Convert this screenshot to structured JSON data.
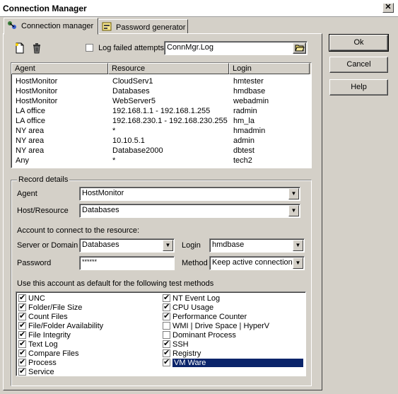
{
  "window": {
    "title": "Connection Manager",
    "close_glyph": "✕"
  },
  "tabs": [
    {
      "label": "Connection manager",
      "active": true
    },
    {
      "label": "Password generator",
      "active": false
    }
  ],
  "toolbar": {
    "log_failed_label": "Log failed attempts",
    "log_file_value": "ConnMgr.Log"
  },
  "list": {
    "headers": {
      "agent": "Agent",
      "resource": "Resource",
      "login": "Login"
    },
    "rows": [
      {
        "agent": "HostMonitor",
        "resource": "CloudServ1",
        "login": "hmtester"
      },
      {
        "agent": "HostMonitor",
        "resource": "Databases",
        "login": "hmdbase"
      },
      {
        "agent": "HostMonitor",
        "resource": "WebServer5",
        "login": "webadmin"
      },
      {
        "agent": "LA office",
        "resource": "192.168.1.1 - 192.168.1.255",
        "login": "radmin"
      },
      {
        "agent": "LA office",
        "resource": "192.168.230.1 - 192.168.230.255",
        "login": "hm_la"
      },
      {
        "agent": "NY area",
        "resource": "*",
        "login": "hmadmin"
      },
      {
        "agent": "NY area",
        "resource": "10.10.5.1",
        "login": "admin"
      },
      {
        "agent": "NY area",
        "resource": "Database2000",
        "login": "dbtest"
      },
      {
        "agent": "Any",
        "resource": "*",
        "login": "tech2"
      }
    ]
  },
  "record": {
    "group_label": "Record details",
    "agent_label": "Agent",
    "agent_value": "HostMonitor",
    "host_label": "Host/Resource",
    "host_value": "Databases",
    "account_label": "Account to connect to the resource:",
    "server_label": "Server or Domain",
    "server_value": "Databases",
    "login_label": "Login",
    "login_value": "hmdbase",
    "password_label": "Password",
    "password_value": "******",
    "method_label": "Method",
    "method_value": "Keep active connection",
    "methods_label": "Use this account as default for the following test methods"
  },
  "methods_left": [
    {
      "label": "UNC",
      "checked": true
    },
    {
      "label": "Folder/File Size",
      "checked": true
    },
    {
      "label": "Count Files",
      "checked": true
    },
    {
      "label": "File/Folder Availability",
      "checked": true
    },
    {
      "label": "File Integrity",
      "checked": true
    },
    {
      "label": "Text Log",
      "checked": true
    },
    {
      "label": "Compare Files",
      "checked": true
    },
    {
      "label": "Process",
      "checked": true
    },
    {
      "label": "Service",
      "checked": true
    }
  ],
  "methods_right": [
    {
      "label": "NT Event Log",
      "checked": true
    },
    {
      "label": "CPU Usage",
      "checked": true
    },
    {
      "label": "Performance Counter",
      "checked": true
    },
    {
      "label": "WMI | Drive Space | HyperV",
      "checked": false
    },
    {
      "label": "Dominant Process",
      "checked": false
    },
    {
      "label": "SSH",
      "checked": true
    },
    {
      "label": "Registry",
      "checked": true
    },
    {
      "label": "VM Ware",
      "checked": true,
      "selected": true
    }
  ],
  "buttons": {
    "ok": "Ok",
    "cancel": "Cancel",
    "help": "Help"
  },
  "colors": {
    "face": "#d4d0c8",
    "selection": "#0a246a"
  }
}
